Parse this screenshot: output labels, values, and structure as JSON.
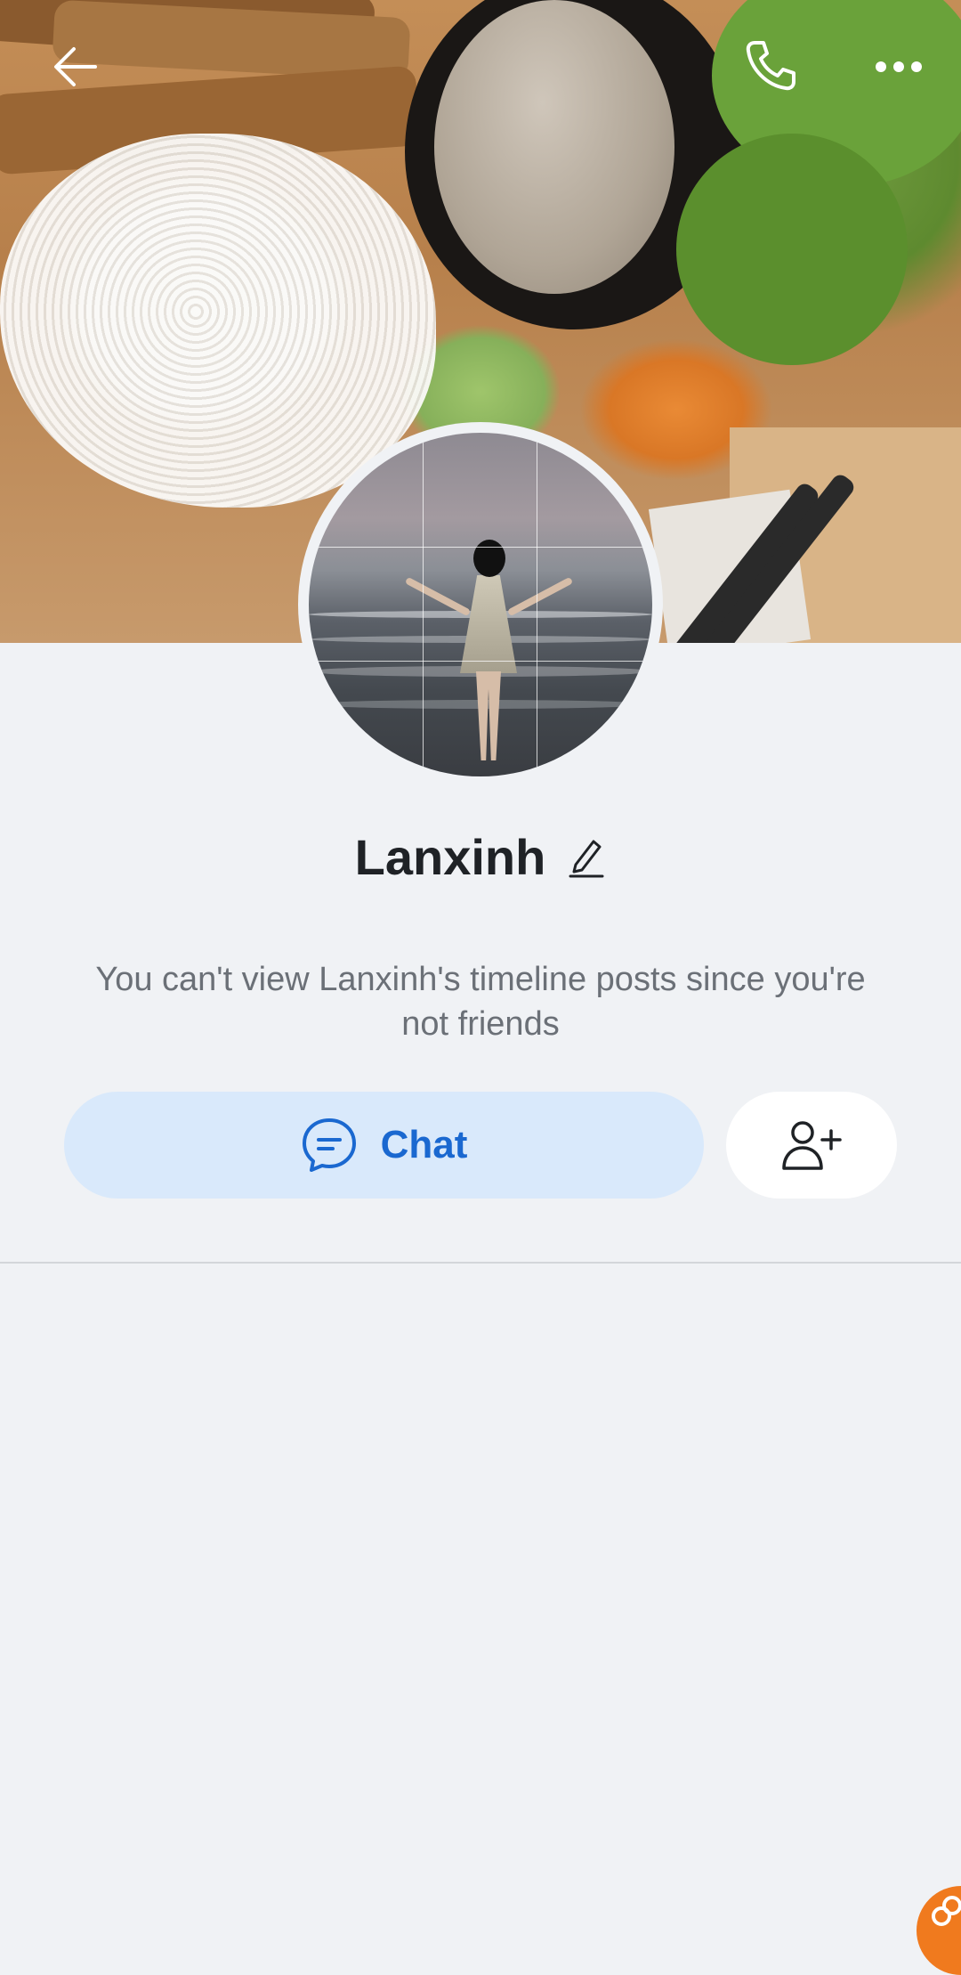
{
  "profile": {
    "name": "Lanxinh",
    "notice": "You can't view Lanxinh's timeline posts since you're not friends"
  },
  "actions": {
    "chat_label": "Chat"
  },
  "icons": {
    "back": "arrow-left-icon",
    "call": "phone-icon",
    "more": "more-horizontal-icon",
    "edit": "pencil-icon",
    "chat": "chat-bubble-icon",
    "add_friend": "add-friend-icon"
  },
  "colors": {
    "accent": "#1a68d0",
    "chat_button_bg": "#d9e9fb",
    "page_bg": "#f0f2f5",
    "floating_badge": "#f07a1e"
  }
}
